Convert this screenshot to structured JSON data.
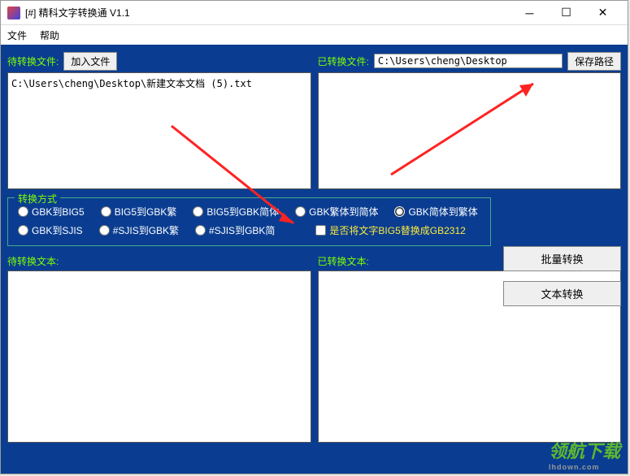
{
  "window": {
    "title": "[#] 精科文字转换通 V1.1"
  },
  "menu": {
    "file": "文件",
    "help": "帮助"
  },
  "left_panel": {
    "label": "待转换文件:",
    "add_button": "加入文件",
    "content": "C:\\Users\\cheng\\Desktop\\新建文本文档 (5).txt"
  },
  "right_panel": {
    "label": "已转换文件:",
    "path": "C:\\Users\\cheng\\Desktop",
    "save_button": "保存路径"
  },
  "options": {
    "legend": "转换方式",
    "radios": [
      {
        "label": "GBK到BIG5",
        "checked": false
      },
      {
        "label": "BIG5到GBK繁",
        "checked": false
      },
      {
        "label": "BIG5到GBK简体",
        "checked": false
      },
      {
        "label": "GBK繁体到简体",
        "checked": false
      },
      {
        "label": "GBK简体到繁体",
        "checked": true
      },
      {
        "label": "GBK到SJIS",
        "checked": false
      },
      {
        "label": "#SJIS到GBK繁",
        "checked": false
      },
      {
        "label": "#SJIS到GBK简",
        "checked": false
      }
    ],
    "checkbox_label": "是否将文字BIG5替换成GB2312"
  },
  "buttons": {
    "batch": "批量转换",
    "text": "文本转换"
  },
  "bottom": {
    "left_label": "待转换文本:",
    "right_label": "已转换文本:"
  },
  "watermark": {
    "main": "领航下载",
    "sub": "lhdown.com"
  }
}
